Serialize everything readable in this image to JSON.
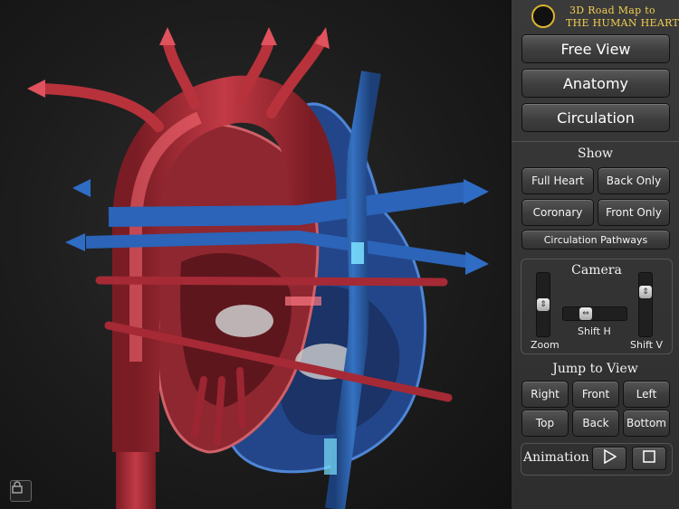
{
  "app": {
    "logo_line1": "3D Road Map to",
    "logo_line2": "THE HUMAN HEART"
  },
  "modes": {
    "free_view": "Free View",
    "anatomy": "Anatomy",
    "circulation": "Circulation"
  },
  "show": {
    "title": "Show",
    "full_heart": "Full Heart",
    "back_only": "Back Only",
    "coronary": "Coronary",
    "front_only": "Front Only",
    "circulation_pathways": "Circulation Pathways"
  },
  "camera": {
    "title": "Camera",
    "zoom": "Zoom",
    "shift_h": "Shift H",
    "shift_v": "Shift V"
  },
  "jump": {
    "title": "Jump to View",
    "right": "Right",
    "front": "Front",
    "left": "Left",
    "top": "Top",
    "back": "Back",
    "bottom": "Bottom"
  },
  "animation": {
    "label": "Animation"
  },
  "icons": {
    "lock": "lock-icon",
    "play": "play-icon",
    "stop": "stop-icon",
    "logo": "heart-logo-icon"
  },
  "colors": {
    "artery": "#b8323c",
    "vein": "#2a5fa8",
    "highlight_red": "#ff7a85",
    "highlight_blue": "#6fd8ff",
    "logo_gold": "#f3cf52"
  }
}
